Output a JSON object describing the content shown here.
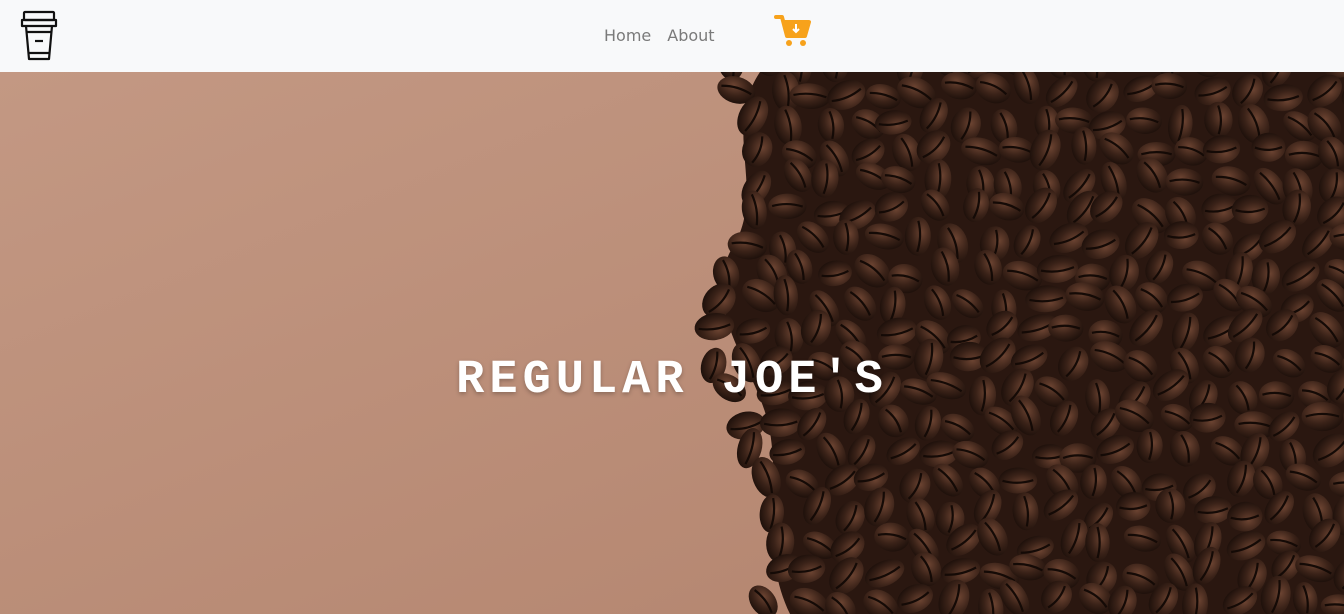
{
  "navbar": {
    "logo_icon": "coffee-cup-icon",
    "links": [
      {
        "label": "Home"
      },
      {
        "label": "About"
      }
    ],
    "cart_icon": "shopping-cart-icon",
    "cart_color": "#f7a21b"
  },
  "hero": {
    "title": "REGULAR JOE'S",
    "background": "coffee-beans-image",
    "paper_color": "#b98a75",
    "bean_color": "#3a2218"
  }
}
